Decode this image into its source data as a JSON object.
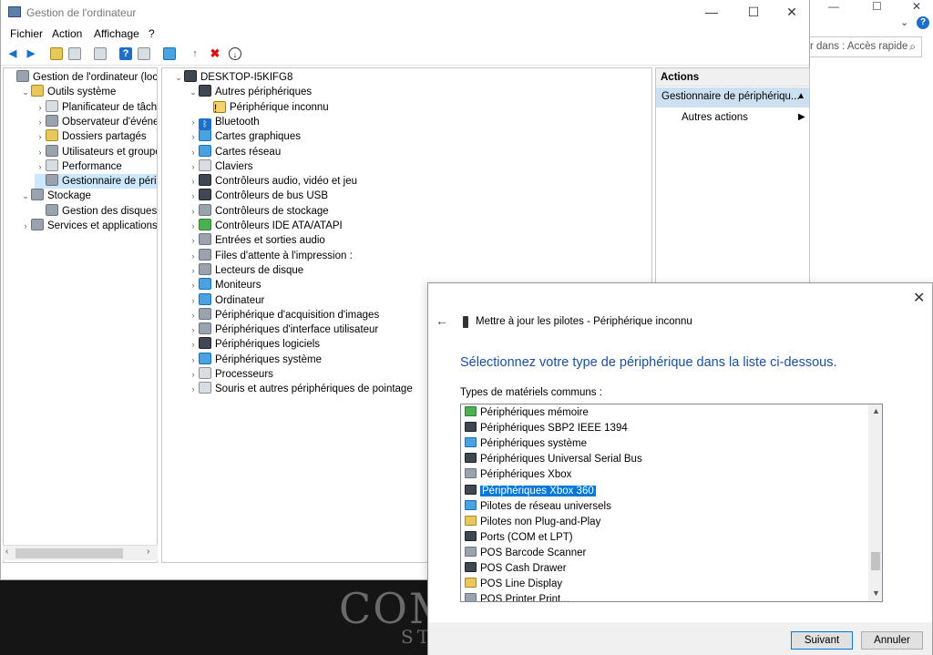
{
  "background": {
    "search_text": "r dans : Accès rapide",
    "logo_text": "COM",
    "logo_sub": "ST"
  },
  "window": {
    "title": "Gestion de l'ordinateur",
    "minimize": "—",
    "maximize": "☐",
    "close": "✕"
  },
  "menu": [
    "Fichier",
    "Action",
    "Affichage",
    "?"
  ],
  "left_tree": [
    {
      "label": "Gestion de l'ordinateur (local)",
      "exp": "",
      "icon": "computer-management-icon",
      "color": "ico-gray",
      "indent": 0
    },
    {
      "label": "Outils système",
      "exp": "⌄",
      "icon": "tools-icon",
      "color": "ico-yellow",
      "indent": 1
    },
    {
      "label": "Planificateur de tâches",
      "exp": "›",
      "icon": "clock-icon",
      "color": "ico-light",
      "indent": 2
    },
    {
      "label": "Observateur d'événeme",
      "exp": "›",
      "icon": "event-viewer-icon",
      "color": "ico-gray",
      "indent": 2
    },
    {
      "label": "Dossiers partagés",
      "exp": "›",
      "icon": "shared-folder-icon",
      "color": "ico-yellow",
      "indent": 2
    },
    {
      "label": "Utilisateurs et groupes l",
      "exp": "›",
      "icon": "users-icon",
      "color": "ico-gray",
      "indent": 2
    },
    {
      "label": "Performance",
      "exp": "›",
      "icon": "performance-icon",
      "color": "ico-light",
      "indent": 2
    },
    {
      "label": "Gestionnaire de périphé",
      "exp": "",
      "icon": "device-manager-icon",
      "color": "ico-gray",
      "indent": 2,
      "selected": true
    },
    {
      "label": "Stockage",
      "exp": "⌄",
      "icon": "storage-icon",
      "color": "ico-gray",
      "indent": 1
    },
    {
      "label": "Gestion des disques",
      "exp": "",
      "icon": "disk-icon",
      "color": "ico-gray",
      "indent": 2
    },
    {
      "label": "Services et applications",
      "exp": "›",
      "icon": "services-icon",
      "color": "ico-gray",
      "indent": 1
    }
  ],
  "device_tree": [
    {
      "label": "DESKTOP-I5KIFG8",
      "exp": "⌄",
      "icon": "computer-icon",
      "color": "ico-dark",
      "indent": 0
    },
    {
      "label": "Autres périphériques",
      "exp": "⌄",
      "icon": "other-devices-icon",
      "color": "ico-dark",
      "indent": 1
    },
    {
      "label": "Périphérique inconnu",
      "exp": "",
      "icon": "unknown-device-warning-icon",
      "color": "ico-warn",
      "indent": 2
    },
    {
      "label": "Bluetooth",
      "exp": "›",
      "icon": "bluetooth-icon",
      "color": "ico-bt",
      "indent": 1
    },
    {
      "label": "Cartes graphiques",
      "exp": "›",
      "icon": "display-adapter-icon",
      "color": "ico-blue",
      "indent": 1
    },
    {
      "label": "Cartes réseau",
      "exp": "›",
      "icon": "network-adapter-icon",
      "color": "ico-blue",
      "indent": 1
    },
    {
      "label": "Claviers",
      "exp": "›",
      "icon": "keyboard-icon",
      "color": "ico-light",
      "indent": 1
    },
    {
      "label": "Contrôleurs audio, vidéo et jeu",
      "exp": "›",
      "icon": "audio-icon",
      "color": "ico-dark",
      "indent": 1
    },
    {
      "label": "Contrôleurs de bus USB",
      "exp": "›",
      "icon": "usb-icon",
      "color": "ico-dark",
      "indent": 1
    },
    {
      "label": "Contrôleurs de stockage",
      "exp": "›",
      "icon": "storage-controller-icon",
      "color": "ico-gray",
      "indent": 1
    },
    {
      "label": "Contrôleurs IDE ATA/ATAPI",
      "exp": "›",
      "icon": "ide-icon",
      "color": "ico-green",
      "indent": 1
    },
    {
      "label": "Entrées et sorties audio",
      "exp": "›",
      "icon": "speaker-icon",
      "color": "ico-gray",
      "indent": 1
    },
    {
      "label": "Files d'attente à l'impression :",
      "exp": "›",
      "icon": "printer-icon",
      "color": "ico-gray",
      "indent": 1
    },
    {
      "label": "Lecteurs de disque",
      "exp": "›",
      "icon": "disk-drive-icon",
      "color": "ico-gray",
      "indent": 1
    },
    {
      "label": "Moniteurs",
      "exp": "›",
      "icon": "monitor-icon",
      "color": "ico-blue",
      "indent": 1
    },
    {
      "label": "Ordinateur",
      "exp": "›",
      "icon": "computer-icon",
      "color": "ico-blue",
      "indent": 1
    },
    {
      "label": "Périphérique d'acquisition d'images",
      "exp": "›",
      "icon": "camera-icon",
      "color": "ico-gray",
      "indent": 1
    },
    {
      "label": "Périphériques d'interface utilisateur",
      "exp": "›",
      "icon": "hid-icon",
      "color": "ico-gray",
      "indent": 1
    },
    {
      "label": "Périphériques logiciels",
      "exp": "›",
      "icon": "software-device-icon",
      "color": "ico-dark",
      "indent": 1
    },
    {
      "label": "Périphériques système",
      "exp": "›",
      "icon": "system-device-icon",
      "color": "ico-blue",
      "indent": 1
    },
    {
      "label": "Processeurs",
      "exp": "›",
      "icon": "processor-icon",
      "color": "ico-light",
      "indent": 1
    },
    {
      "label": "Souris et autres périphériques de pointage",
      "exp": "›",
      "icon": "mouse-icon",
      "color": "ico-light",
      "indent": 1
    }
  ],
  "actions": {
    "header": "Actions",
    "selected": "Gestionnaire de périphériqu...",
    "more": "Autres actions"
  },
  "dialog": {
    "title": "Mettre à jour les pilotes - Périphérique inconnu",
    "heading": "Sélectionnez votre type de périphérique dans la liste ci-dessous.",
    "list_label": "Types de matériels communs :",
    "items": [
      {
        "label": "Périphériques mémoire",
        "icon": "memory-icon",
        "color": "ico-green"
      },
      {
        "label": "Périphériques SBP2 IEEE 1394",
        "icon": "firewire-icon",
        "color": "ico-dark"
      },
      {
        "label": "Périphériques système",
        "icon": "system-device-icon",
        "color": "ico-blue"
      },
      {
        "label": "Périphériques Universal Serial Bus",
        "icon": "usb-icon",
        "color": "ico-dark"
      },
      {
        "label": "Périphériques Xbox",
        "icon": "xbox-icon",
        "color": "ico-gray"
      },
      {
        "label": "Périphériques Xbox 360",
        "icon": "gamepad-icon",
        "color": "ico-dark",
        "selected": true
      },
      {
        "label": "Pilotes de réseau universels",
        "icon": "network-icon",
        "color": "ico-blue"
      },
      {
        "label": "Pilotes non Plug-and-Play",
        "icon": "driver-icon",
        "color": "ico-yellow"
      },
      {
        "label": "Ports (COM et LPT)",
        "icon": "port-icon",
        "color": "ico-dark"
      },
      {
        "label": "POS Barcode Scanner",
        "icon": "barcode-icon",
        "color": "ico-gray"
      },
      {
        "label": "POS Cash Drawer",
        "icon": "cash-drawer-icon",
        "color": "ico-dark"
      },
      {
        "label": "POS Line Display",
        "icon": "line-display-icon",
        "color": "ico-yellow"
      },
      {
        "label": "POS Printer Print...",
        "icon": "pos-printer-icon",
        "color": "ico-gray"
      }
    ],
    "next": "Suivant",
    "cancel": "Annuler"
  }
}
